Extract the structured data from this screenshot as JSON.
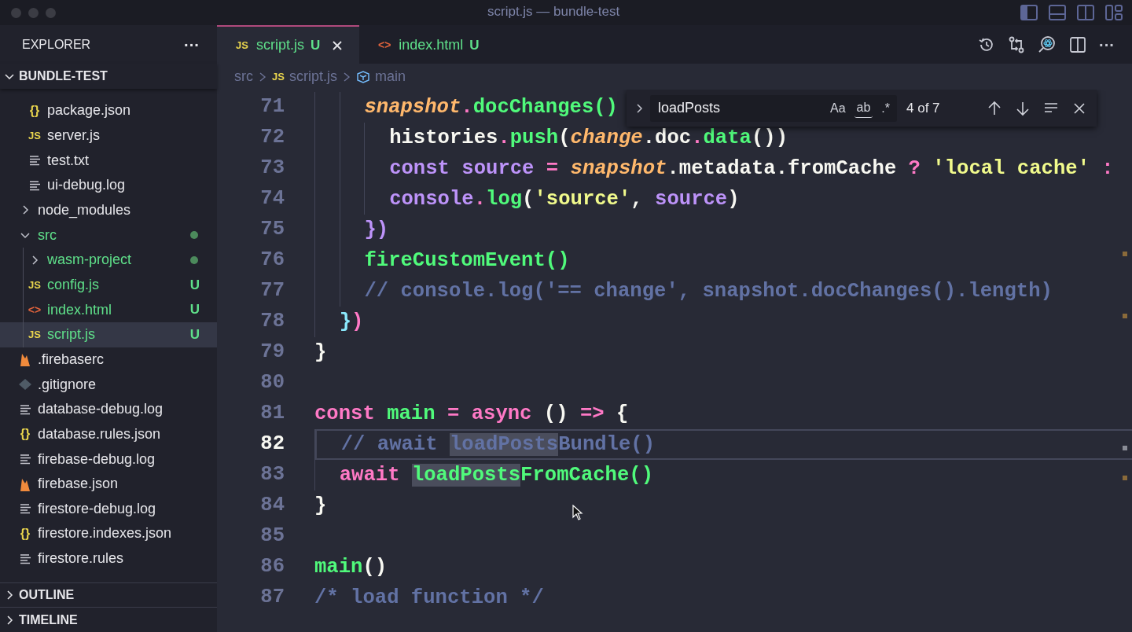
{
  "window": {
    "title": "script.js — bundle-test",
    "layout_toggles": [
      {
        "kind": "sidebar",
        "on": true
      },
      {
        "kind": "panel",
        "on": false
      },
      {
        "kind": "secondary",
        "on": false
      },
      {
        "kind": "customize",
        "on": false
      }
    ]
  },
  "sidebar": {
    "title": "EXPLORER",
    "more": "···",
    "folder": {
      "label": "BUNDLE-TEST",
      "expanded": true
    },
    "tree": [
      {
        "kind": "offscreen-folder",
        "children": [
          {
            "kind": "file",
            "name": "package.json",
            "icon": {
              "kind": "json",
              "glyph": "{}"
            },
            "untracked": false,
            "selected": false
          },
          {
            "kind": "file",
            "name": "server.js",
            "icon": {
              "kind": "js",
              "glyph": "JS"
            },
            "untracked": false,
            "selected": false
          },
          {
            "kind": "file",
            "name": "test.txt",
            "icon": {
              "kind": "text"
            },
            "untracked": false,
            "selected": false
          },
          {
            "kind": "file",
            "name": "ui-debug.log",
            "icon": {
              "kind": "text"
            },
            "untracked": false,
            "selected": false
          }
        ]
      },
      {
        "kind": "folder",
        "name": "node_modules",
        "expanded": false,
        "untracked": false,
        "selected": false
      },
      {
        "kind": "folder",
        "name": "src",
        "expanded": true,
        "untracked": true,
        "dot": true,
        "selected": false,
        "children": [
          {
            "kind": "folder",
            "name": "wasm-project",
            "expanded": false,
            "untracked": true,
            "dot": true,
            "selected": false
          },
          {
            "kind": "file",
            "name": "config.js",
            "icon": {
              "kind": "js",
              "glyph": "JS"
            },
            "untracked": true,
            "badge": "U",
            "selected": false
          },
          {
            "kind": "file",
            "name": "index.html",
            "icon": {
              "kind": "html",
              "glyph": "<>"
            },
            "untracked": true,
            "badge": "U",
            "selected": false
          },
          {
            "kind": "file",
            "name": "script.js",
            "icon": {
              "kind": "js",
              "glyph": "JS"
            },
            "untracked": true,
            "badge": "U",
            "selected": true
          }
        ]
      },
      {
        "kind": "file",
        "name": ".firebaserc",
        "icon": {
          "kind": "firebase"
        },
        "untracked": false,
        "selected": false
      },
      {
        "kind": "file",
        "name": ".gitignore",
        "icon": {
          "kind": "git"
        },
        "untracked": false,
        "selected": false
      },
      {
        "kind": "file",
        "name": "database-debug.log",
        "icon": {
          "kind": "text"
        },
        "untracked": false,
        "selected": false
      },
      {
        "kind": "file",
        "name": "database.rules.json",
        "icon": {
          "kind": "json",
          "glyph": "{}"
        },
        "untracked": false,
        "selected": false
      },
      {
        "kind": "file",
        "name": "firebase-debug.log",
        "icon": {
          "kind": "text"
        },
        "untracked": false,
        "selected": false
      },
      {
        "kind": "file",
        "name": "firebase.json",
        "icon": {
          "kind": "firebase"
        },
        "untracked": false,
        "selected": false
      },
      {
        "kind": "file",
        "name": "firestore-debug.log",
        "icon": {
          "kind": "text"
        },
        "untracked": false,
        "selected": false
      },
      {
        "kind": "file",
        "name": "firestore.indexes.json",
        "icon": {
          "kind": "json",
          "glyph": "{}"
        },
        "untracked": false,
        "selected": false
      },
      {
        "kind": "file",
        "name": "firestore.rules",
        "icon": {
          "kind": "text"
        },
        "untracked": false,
        "selected": false
      }
    ],
    "sections": [
      {
        "label": "OUTLINE",
        "expanded": false
      },
      {
        "label": "TIMELINE",
        "expanded": false
      }
    ]
  },
  "tabs": [
    {
      "label": "script.js",
      "icon": {
        "kind": "js",
        "glyph": "JS"
      },
      "badge": "U",
      "selected": true
    },
    {
      "label": "index.html",
      "icon": {
        "kind": "html",
        "glyph": "<>"
      },
      "badge": "U",
      "selected": false
    }
  ],
  "editor_actions": [
    {
      "kind": "history"
    },
    {
      "kind": "compare"
    },
    {
      "kind": "react-search"
    },
    {
      "kind": "split"
    },
    {
      "kind": "more",
      "glyph": "···"
    }
  ],
  "breadcrumbs": [
    {
      "kind": "folder",
      "label": "src"
    },
    {
      "kind": "js",
      "glyph": "JS",
      "label": "script.js"
    },
    {
      "kind": "symbol",
      "label": "main"
    }
  ],
  "find": {
    "query": "loadPosts",
    "options": [
      {
        "glyph": "Aa",
        "kind": "case",
        "on": false
      },
      {
        "glyph": "ab",
        "kind": "word",
        "on": false
      },
      {
        "glyph": ".*",
        "kind": "regex",
        "on": false
      }
    ],
    "count": "4 of 7"
  },
  "code": [
    {
      "n": "71",
      "tokens": [
        {
          "t": "    snapshot",
          "kind": "param"
        },
        {
          "t": ".",
          "kind": "kw"
        },
        {
          "t": "docChanges()",
          "kind": "fn"
        }
      ]
    },
    {
      "n": "72",
      "tokens": [
        {
          "t": "      histories",
          "kind": "plain"
        },
        {
          "t": ".",
          "kind": "kw"
        },
        {
          "t": "push",
          "kind": "fn"
        },
        {
          "t": "(",
          "kind": "plain"
        },
        {
          "t": "change",
          "kind": "param"
        },
        {
          "t": ".doc",
          "kind": "plain"
        },
        {
          "t": ".",
          "kind": "kw"
        },
        {
          "t": "data",
          "kind": "fn"
        },
        {
          "t": "())",
          "kind": "plain"
        }
      ]
    },
    {
      "n": "73",
      "tokens": [
        {
          "t": "      const",
          "kind": "var"
        },
        {
          "t": " source",
          "kind": "var"
        },
        {
          "t": " =",
          "kind": "kw"
        },
        {
          "t": " snapshot",
          "kind": "param"
        },
        {
          "t": ".metadata.fromCache",
          "kind": "plain"
        },
        {
          "t": " ?",
          "kind": "kw"
        },
        {
          "t": " 'local cache'",
          "kind": "str"
        },
        {
          "t": " :",
          "kind": "kw"
        }
      ]
    },
    {
      "n": "74",
      "tokens": [
        {
          "t": "      console",
          "kind": "var"
        },
        {
          "t": ".",
          "kind": "kw"
        },
        {
          "t": "log",
          "kind": "fn"
        },
        {
          "t": "(",
          "kind": "plain"
        },
        {
          "t": "'source'",
          "kind": "str"
        },
        {
          "t": ",",
          "kind": "plain"
        },
        {
          "t": " source",
          "kind": "var"
        },
        {
          "t": ")",
          "kind": "plain"
        }
      ]
    },
    {
      "n": "75",
      "tokens": [
        {
          "t": "    })",
          "kind": "var"
        }
      ]
    },
    {
      "n": "76",
      "tokens": [
        {
          "t": "    fireCustomEvent()",
          "kind": "fn"
        }
      ]
    },
    {
      "n": "77",
      "tokens": [
        {
          "t": "    // console.log('== change', snapshot.docChanges().length)",
          "kind": "cmt"
        }
      ]
    },
    {
      "n": "78",
      "tokens": [
        {
          "t": "  }",
          "kind": "bracket"
        },
        {
          "t": ")",
          "kind": "kw"
        }
      ]
    },
    {
      "n": "79",
      "tokens": [
        {
          "t": "}",
          "kind": "plain"
        }
      ]
    },
    {
      "n": "80"
    },
    {
      "n": "81",
      "tokens": [
        {
          "t": "const",
          "kind": "kw"
        },
        {
          "t": " main",
          "kind": "fn"
        },
        {
          "t": " =",
          "kind": "kw"
        },
        {
          "t": " async",
          "kind": "kw"
        },
        {
          "t": " ()",
          "kind": "plain"
        },
        {
          "t": " =>",
          "kind": "kw"
        },
        {
          "t": " {",
          "kind": "plain"
        }
      ]
    },
    {
      "n": "82",
      "current": true,
      "tokens": [
        {
          "t": "  // await ",
          "kind": "cmt"
        },
        {
          "t": "loadPosts",
          "kind": "cmt",
          "match": true
        },
        {
          "t": "Bundle()",
          "kind": "cmt"
        }
      ]
    },
    {
      "n": "83",
      "tokens": [
        {
          "t": "  await ",
          "kind": "kw"
        },
        {
          "t": "loadPosts",
          "kind": "fn",
          "match": true
        },
        {
          "t": "FromCache()",
          "kind": "fn"
        }
      ]
    },
    {
      "n": "84",
      "tokens": [
        {
          "t": "}",
          "kind": "plain"
        }
      ]
    },
    {
      "n": "85"
    },
    {
      "n": "86",
      "tokens": [
        {
          "t": "main",
          "kind": "fn"
        },
        {
          "t": "()",
          "kind": "plain"
        }
      ]
    },
    {
      "n": "87",
      "tokens": [
        {
          "t": "/* load function */",
          "kind": "cmt"
        }
      ]
    }
  ]
}
